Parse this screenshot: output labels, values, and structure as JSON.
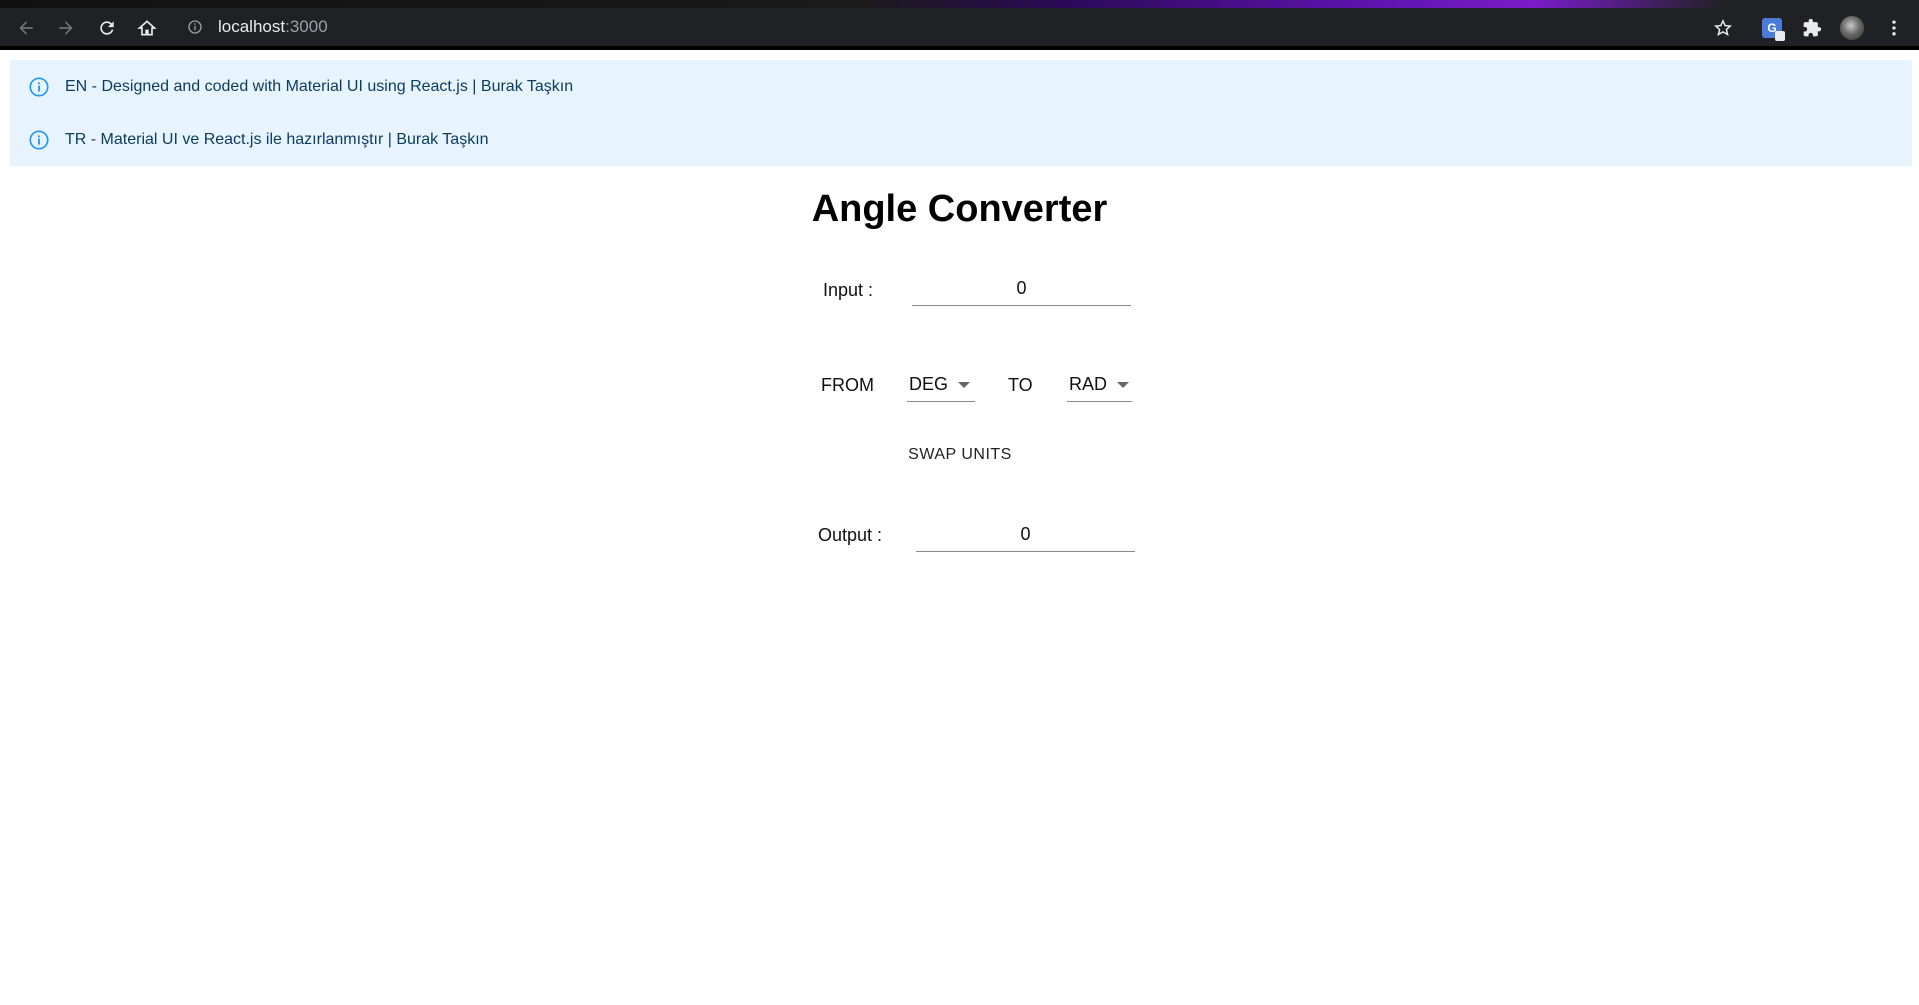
{
  "browser": {
    "url_host": "localhost",
    "url_port": ":3000",
    "icons": [
      "back-icon",
      "forward-icon",
      "reload-icon",
      "home-icon",
      "site-info-icon",
      "bookmark-star-icon",
      "translate-icon",
      "extensions-icon",
      "profile-avatar",
      "menu-icon"
    ]
  },
  "alerts": [
    {
      "text": "EN - Designed and coded with Material UI using React.js | Burak Taşkın",
      "icon": "info-icon"
    },
    {
      "text": "TR - Material UI ve React.js ile hazırlanmıştır | Burak Taşkın",
      "icon": "info-icon"
    }
  ],
  "converter": {
    "title": "Angle Converter",
    "input_label": "Input :",
    "input_value": "0",
    "from_label": "FROM",
    "from_unit": "DEG",
    "to_label": "TO",
    "to_unit": "RAD",
    "swap_label": "SWAP UNITS",
    "output_label": "Output :",
    "output_value": "0"
  },
  "colors": {
    "alert_background": "#e8f4fd",
    "alert_icon": "#2196f3",
    "alert_text": "#0d3c61"
  }
}
